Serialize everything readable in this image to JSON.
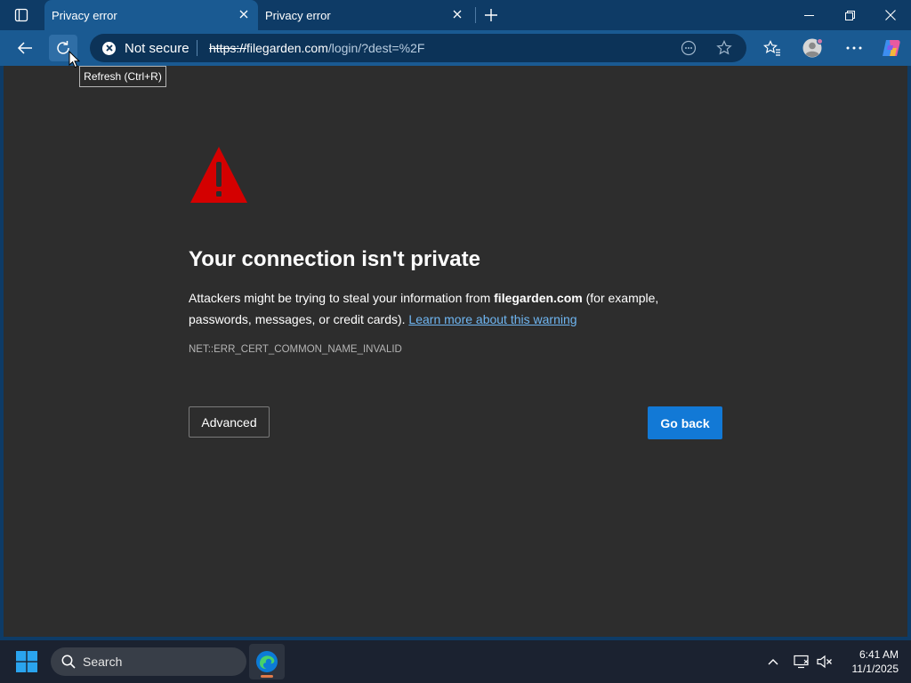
{
  "browser": {
    "tabs": [
      {
        "title": "Privacy error",
        "active": true
      },
      {
        "title": "Privacy error",
        "active": false
      }
    ],
    "omnibox": {
      "security_label": "Not secure",
      "url_scheme": "https://",
      "url_host": "filegarden.com",
      "url_path": "/login/?dest=%2F"
    },
    "tooltip": "Refresh (Ctrl+R)"
  },
  "page": {
    "headline": "Your connection isn't private",
    "desc_prefix": "Attackers might be trying to steal your information from ",
    "desc_host": "filegarden.com",
    "desc_suffix": " (for example, passwords, messages, or credit cards). ",
    "learn_more": "Learn more about this warning",
    "error_code": "NET::ERR_CERT_COMMON_NAME_INVALID",
    "advanced_label": "Advanced",
    "goback_label": "Go back"
  },
  "taskbar": {
    "search_label": "Search",
    "time": "6:41 AM",
    "date": "11/1/2025"
  },
  "colors": {
    "accent": "#1279d6",
    "warning_red": "#d40000",
    "link": "#6fb6f2",
    "page_bg": "#2d2d2d"
  }
}
